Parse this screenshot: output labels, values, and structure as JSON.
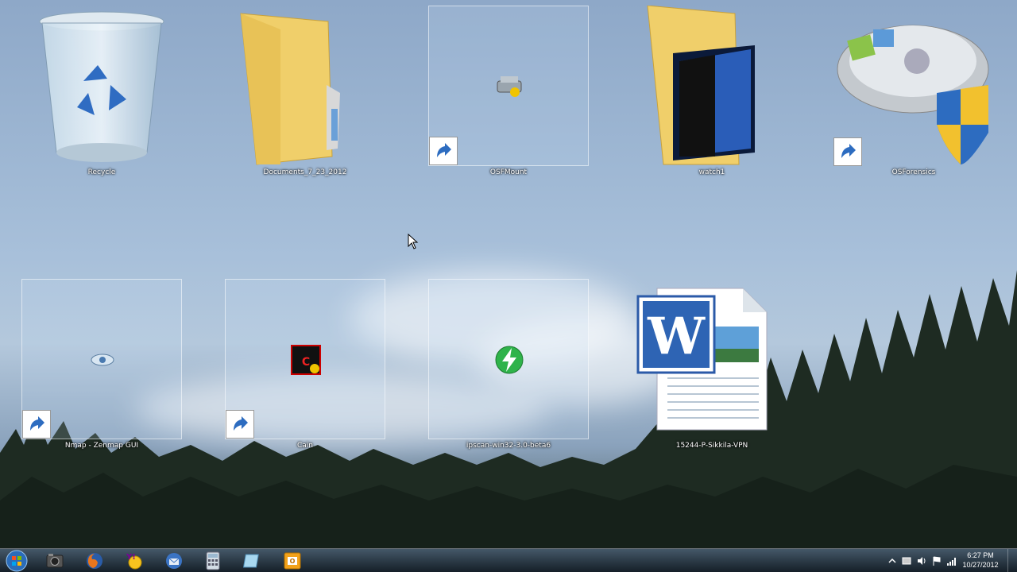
{
  "desktop": {
    "icons": [
      {
        "label": "Recycle",
        "icon": "recycle-bin-icon"
      },
      {
        "label": "Documents_7_23_2012",
        "icon": "folder-icon"
      },
      {
        "label": "OSFMount",
        "icon": "osfmount-icon",
        "shortcut": true
      },
      {
        "label": "watch1",
        "icon": "folder-with-image-icon"
      },
      {
        "label": "OSForensics",
        "icon": "osforensics-icon",
        "shortcut": true
      },
      {
        "label": "Nmap - Zenmap GUI",
        "icon": "nmap-eye-icon",
        "shortcut": true
      },
      {
        "label": "Cain",
        "icon": "cain-icon",
        "shortcut": true
      },
      {
        "label": "ipscan-win32-3.0-beta6",
        "icon": "ipscan-icon"
      },
      {
        "label": "15244-P-Sikkila-VPN",
        "icon": "word-document-icon"
      }
    ]
  },
  "taskbar": {
    "start": "windows-start-icon",
    "pinned": [
      "explorer-icon",
      "firefox-icon",
      "yahoo-messenger-icon",
      "thunderbird-icon",
      "calculator-icon",
      "notepad-icon",
      "outlook-icon"
    ],
    "tray": {
      "time": "6:27 PM",
      "date": "10/27/2012"
    }
  },
  "colors": {
    "accent": "#2d6cc0",
    "taskbar": "#1c2834"
  }
}
